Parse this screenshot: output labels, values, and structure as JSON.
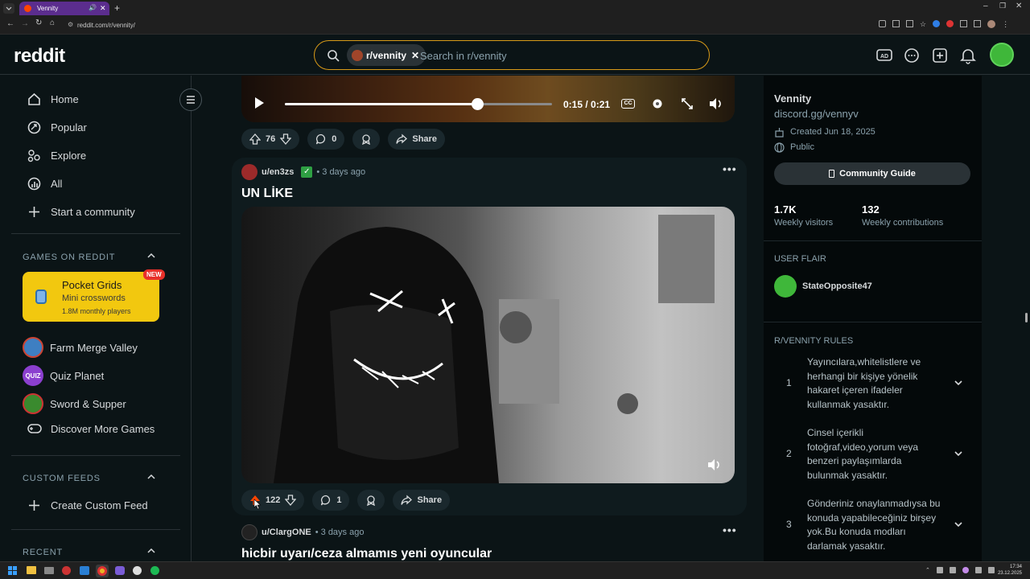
{
  "browser": {
    "tab_title": "Vennity",
    "url": "reddit.com/r/vennity/"
  },
  "header": {
    "logo": "reddit",
    "search_chip": "r/vennity",
    "search_placeholder": "Search in r/vennity"
  },
  "sidebar": {
    "nav": [
      {
        "label": "Home",
        "icon": "home-icon"
      },
      {
        "label": "Popular",
        "icon": "popular-icon"
      },
      {
        "label": "Explore",
        "icon": "explore-icon"
      },
      {
        "label": "All",
        "icon": "all-icon"
      },
      {
        "label": "Start a community",
        "icon": "plus-icon"
      }
    ],
    "games_heading": "GAMES ON REDDIT",
    "featured_game": {
      "title": "Pocket Grids",
      "subtitle": "Mini crosswords",
      "players": "1.8M monthly players",
      "badge": "NEW"
    },
    "games": [
      {
        "label": "Farm Merge Valley"
      },
      {
        "label": "Quiz Planet"
      },
      {
        "label": "Sword & Supper"
      },
      {
        "label": "Discover More Games"
      }
    ],
    "custom_feeds_heading": "CUSTOM FEEDS",
    "create_feed": "Create Custom Feed",
    "recent_heading": "RECENT"
  },
  "feed": {
    "video1": {
      "time": "0:15 / 0:21",
      "progress": 0.72,
      "upvotes": "76",
      "comments": "0",
      "share": "Share"
    },
    "post2": {
      "author": "u/en3zs",
      "time": "• 3 days ago",
      "title": "UN LİKE",
      "upvotes": "122",
      "comments": "1",
      "share": "Share"
    },
    "post3": {
      "author": "u/ClargONE",
      "time": "• 3 days ago",
      "title": "hicbir uyarı/ceza almamıs yeni oyuncular"
    }
  },
  "right": {
    "community_name": "Vennity",
    "community_link": "discord.gg/vennyv",
    "created": "Created Jun 18, 2025",
    "visibility": "Public",
    "guide_button": "Community Guide",
    "stats": [
      {
        "value": "1.7K",
        "label": "Weekly visitors"
      },
      {
        "value": "132",
        "label": "Weekly contributions"
      }
    ],
    "user_flair_heading": "USER FLAIR",
    "flair_user": "StateOpposite47",
    "rules_heading": "R/VENNITY RULES",
    "rules": [
      {
        "num": "1",
        "text": "Yayıncılara,whitelistlere ve herhangi bir kişiye yönelik hakaret içeren ifadeler kullanmak yasaktır."
      },
      {
        "num": "2",
        "text": "Cinsel içerikli fotoğraf,video,yorum veya benzeri paylaşımlarda bulunmak yasaktır."
      },
      {
        "num": "3",
        "text": "Gönderiniz onaylanmadıysa bu konuda yapabileceğiniz birşey yok.Bu konuda modları darlamak yasaktır."
      }
    ]
  },
  "taskbar": {
    "time": "17:34",
    "date": "23.12.2025"
  },
  "colors": {
    "accent_search": "#d89a18",
    "pocket_yellow": "#f2c80f",
    "new_badge": "#e8302a",
    "page_bg": "#0b1416"
  }
}
